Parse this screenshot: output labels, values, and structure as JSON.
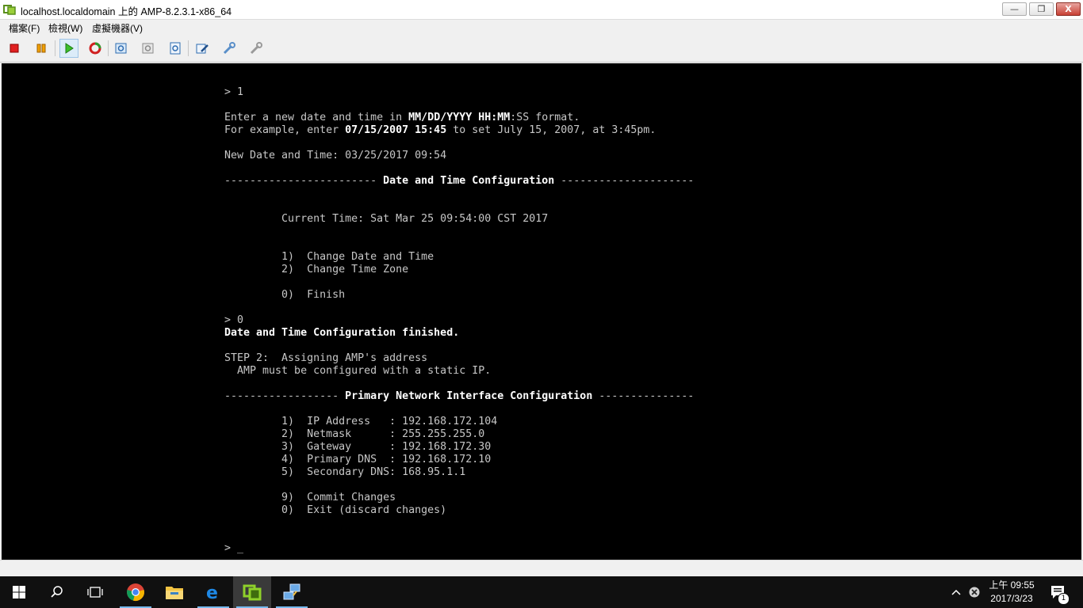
{
  "window": {
    "title": "localhost.localdomain 上的 AMP-8.2.3.1-x86_64",
    "minimize_glyph": "—",
    "restore_glyph": "❐",
    "close_glyph": "X"
  },
  "menu": {
    "items": [
      {
        "label": "檔案(F)"
      },
      {
        "label": "檢視(W)"
      },
      {
        "label": "虛擬機器(V)"
      }
    ]
  },
  "toolbar": {
    "icons": [
      "stop-icon",
      "pause-icon",
      "play-icon",
      "reset-icon",
      "snapshot-icon",
      "revert-icon",
      "settings-icon",
      "edit-settings-icon",
      "tools-icon",
      "help-icon"
    ]
  },
  "console": {
    "lines": [
      {
        "segments": [
          {
            "t": "> 1",
            "b": false
          }
        ]
      },
      {
        "segments": []
      },
      {
        "segments": [
          {
            "t": "Enter a new date and time in ",
            "b": false
          },
          {
            "t": "MM/DD/YYYY HH:MM",
            "b": true
          },
          {
            "t": ":SS format.",
            "b": false
          }
        ]
      },
      {
        "segments": [
          {
            "t": "For example, enter ",
            "b": false
          },
          {
            "t": "07/15/2007 15:45",
            "b": true
          },
          {
            "t": " to set July 15, 2007, at 3:45pm.",
            "b": false
          }
        ]
      },
      {
        "segments": []
      },
      {
        "segments": [
          {
            "t": "New Date and Time: 03/25/2017 09:54",
            "b": false
          }
        ]
      },
      {
        "segments": []
      },
      {
        "segments": [
          {
            "t": "------------------------ ",
            "b": false
          },
          {
            "t": "Date and Time Configuration",
            "b": true
          },
          {
            "t": " ---------------------",
            "b": false
          }
        ]
      },
      {
        "segments": []
      },
      {
        "segments": []
      },
      {
        "segments": [
          {
            "t": "         Current Time: Sat Mar 25 09:54:00 CST 2017",
            "b": false
          }
        ]
      },
      {
        "segments": []
      },
      {
        "segments": []
      },
      {
        "segments": [
          {
            "t": "         1)  Change Date and Time",
            "b": false
          }
        ]
      },
      {
        "segments": [
          {
            "t": "         2)  Change Time Zone",
            "b": false
          }
        ]
      },
      {
        "segments": []
      },
      {
        "segments": [
          {
            "t": "         0)  Finish",
            "b": false
          }
        ]
      },
      {
        "segments": []
      },
      {
        "segments": [
          {
            "t": "> 0",
            "b": false
          }
        ]
      },
      {
        "segments": [
          {
            "t": "Date and Time Configuration finished.",
            "b": true
          }
        ]
      },
      {
        "segments": []
      },
      {
        "segments": [
          {
            "t": "STEP 2:  Assigning AMP's address",
            "b": false
          }
        ]
      },
      {
        "segments": [
          {
            "t": "  AMP must be configured with a static IP.",
            "b": false
          }
        ]
      },
      {
        "segments": []
      },
      {
        "segments": [
          {
            "t": "------------------ ",
            "b": false
          },
          {
            "t": "Primary Network Interface Configuration",
            "b": true
          },
          {
            "t": " ---------------",
            "b": false
          }
        ]
      },
      {
        "segments": []
      },
      {
        "segments": [
          {
            "t": "         1)  IP Address   : 192.168.172.104",
            "b": false
          }
        ]
      },
      {
        "segments": [
          {
            "t": "         2)  Netmask      : 255.255.255.0",
            "b": false
          }
        ]
      },
      {
        "segments": [
          {
            "t": "         3)  Gateway      : 192.168.172.30",
            "b": false
          }
        ]
      },
      {
        "segments": [
          {
            "t": "         4)  Primary DNS  : 192.168.172.10",
            "b": false
          }
        ]
      },
      {
        "segments": [
          {
            "t": "         5)  Secondary DNS: 168.95.1.1",
            "b": false
          }
        ]
      },
      {
        "segments": []
      },
      {
        "segments": [
          {
            "t": "         9)  Commit Changes",
            "b": false
          }
        ]
      },
      {
        "segments": [
          {
            "t": "         0)  Exit (discard changes)",
            "b": false
          }
        ]
      },
      {
        "segments": []
      },
      {
        "segments": []
      },
      {
        "segments": [
          {
            "t": "> _",
            "b": false
          }
        ]
      }
    ]
  },
  "taskbar": {
    "apps": [
      "start-icon",
      "search-icon",
      "task-view-icon",
      "chrome-icon",
      "file-explorer-icon",
      "edge-icon",
      "vm-console-icon",
      "network-app-icon"
    ],
    "clock_time": "上午 09:55",
    "clock_date": "2017/3/23",
    "notification_count": "1"
  }
}
